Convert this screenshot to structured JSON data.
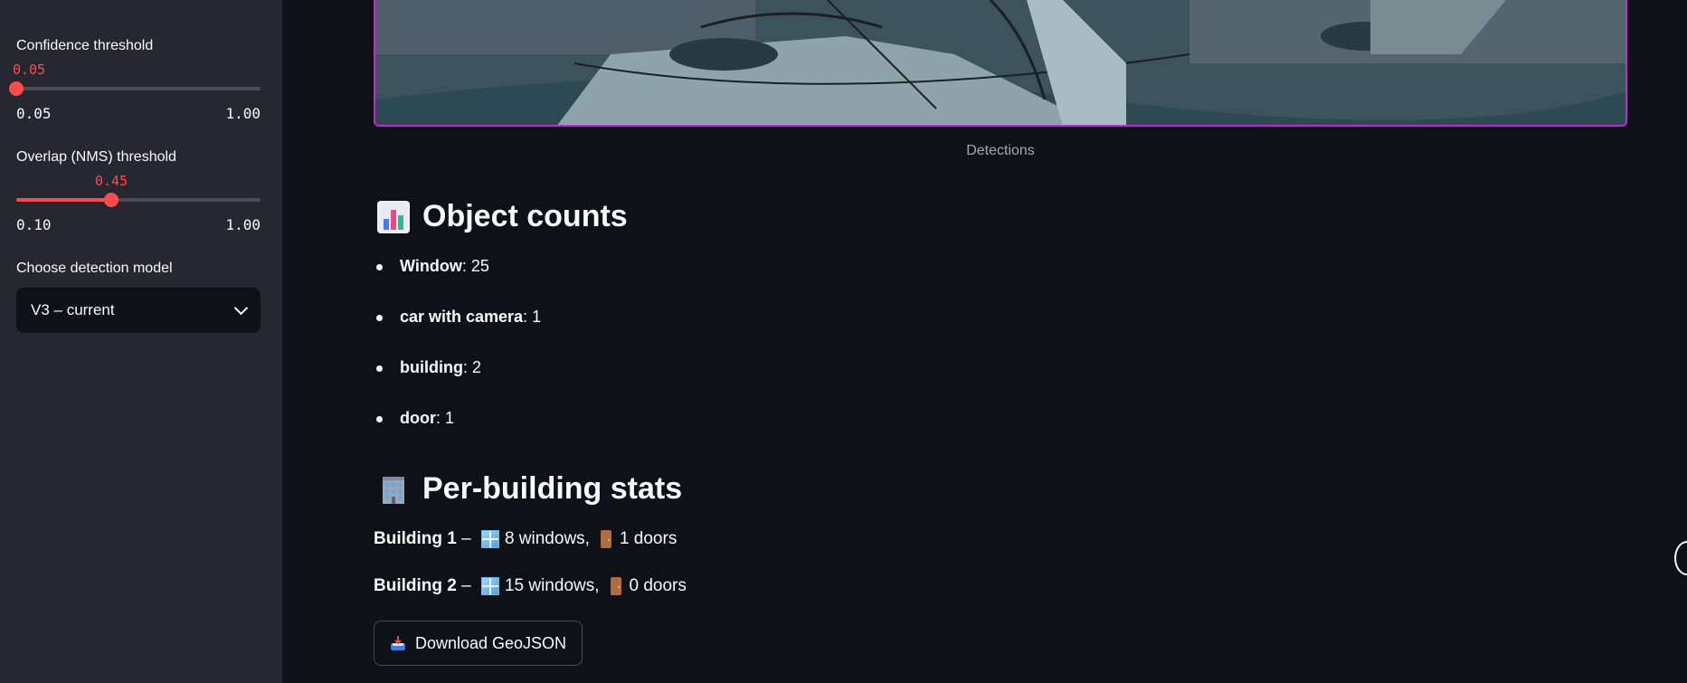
{
  "sidebar": {
    "confidence": {
      "label": "Confidence threshold",
      "value": "0.05",
      "min": "0.05",
      "max": "1.00",
      "fraction": 0.0
    },
    "overlap": {
      "label": "Overlap (NMS) threshold",
      "value": "0.45",
      "min": "0.10",
      "max": "1.00",
      "fraction": 0.389
    },
    "model": {
      "label": "Choose detection model",
      "selected": "V3 – current"
    }
  },
  "main": {
    "image_caption": "Detections",
    "counts_title": "Object counts",
    "counts_icon": "bar-chart-emoji",
    "counts": [
      {
        "name": "Window",
        "value": ": 25"
      },
      {
        "name": "car with camera",
        "value": ": 1"
      },
      {
        "name": "building",
        "value": ": 2"
      },
      {
        "name": "door",
        "value": ": 1"
      }
    ],
    "stats_title": "Per-building stats",
    "stats_icon": "office-building-emoji",
    "buildings": [
      {
        "name": "Building 1",
        "sep": " – ",
        "windows": "8 windows,",
        "doors": "1 doors"
      },
      {
        "name": "Building 2",
        "sep": " – ",
        "windows": "15 windows,",
        "doors": "0 doors"
      }
    ],
    "download_label": "Download GeoJSON",
    "download_icon": "inbox-tray-emoji"
  },
  "colors": {
    "accent": "#ff4b4b",
    "background": "#0e1117",
    "sidebar": "#262730",
    "image_border": "#c32ad1"
  }
}
